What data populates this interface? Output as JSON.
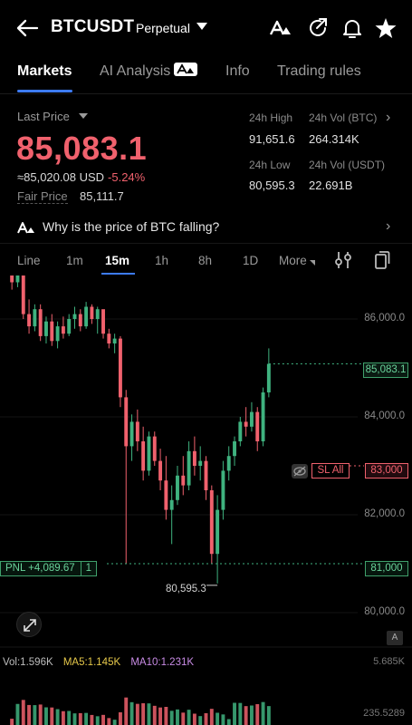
{
  "header": {
    "symbol": "BTCUSDT",
    "contract_type": "Perpetual",
    "icons": [
      "back-arrow-icon",
      "ai-assistant-icon",
      "share-refresh-icon",
      "bell-icon",
      "star-icon"
    ]
  },
  "tabs": [
    {
      "label": "Markets",
      "active": true
    },
    {
      "label": "AI Analysis",
      "badge": "AI"
    },
    {
      "label": "Info"
    },
    {
      "label": "Trading rules"
    }
  ],
  "ticker": {
    "last_price_label": "Last Price",
    "last_price": "85,083.1",
    "usd_equiv": "≈85,020.08 USD",
    "change_pct": "-5.24%",
    "fair_price_label": "Fair Price",
    "fair_price": "85,111.7",
    "high_label": "24h High",
    "high": "91,651.6",
    "vol_btc_label": "24h Vol (BTC)",
    "vol_btc": "264.314K",
    "low_label": "24h Low",
    "low": "80,595.3",
    "vol_usdt_label": "24h Vol (USDT)",
    "vol_usdt": "22.691B"
  },
  "ai_prompt": {
    "text": "Why is the price of BTC falling?"
  },
  "intervals": [
    {
      "label": "Line"
    },
    {
      "label": "1m"
    },
    {
      "label": "15m",
      "active": true
    },
    {
      "label": "1h"
    },
    {
      "label": "8h"
    },
    {
      "label": "1D"
    },
    {
      "label": "More"
    }
  ],
  "chart": {
    "y_ticks": [
      "86,000.0",
      "84,000.0",
      "82,000.0",
      "80,000.0"
    ],
    "current_price_tag": "85,083.1",
    "sl_label": "SL  All",
    "sl_price": "83,000",
    "pnl_label": "PNL +4,089.67",
    "position_qty": "1",
    "position_price": "81,000",
    "low_marker": "80,595.3",
    "auto_badge": "A",
    "colors": {
      "up": "#3fb27f",
      "down": "#f0616d",
      "accent": "#3d7bf7"
    }
  },
  "chart_data": {
    "type": "candlestick",
    "ylim": [
      79700,
      87100
    ],
    "candles": [
      [
        87100,
        87200,
        86600,
        86750
      ],
      [
        86750,
        87050,
        86650,
        86900
      ],
      [
        86900,
        87000,
        86000,
        86100
      ],
      [
        86100,
        86400,
        85700,
        85850
      ],
      [
        85850,
        86300,
        85750,
        86200
      ],
      [
        86200,
        86300,
        85550,
        85650
      ],
      [
        85650,
        86050,
        85500,
        85950
      ],
      [
        85950,
        86100,
        85450,
        85550
      ],
      [
        85550,
        85950,
        85400,
        85850
      ],
      [
        85850,
        86050,
        85600,
        85700
      ],
      [
        85700,
        86100,
        85650,
        86000
      ],
      [
        86000,
        86250,
        85800,
        86100
      ],
      [
        86100,
        86200,
        85750,
        85850
      ],
      [
        85850,
        86350,
        85800,
        86250
      ],
      [
        86250,
        86300,
        85900,
        86000
      ],
      [
        86000,
        86250,
        85700,
        86200
      ],
      [
        86200,
        86150,
        85600,
        85700
      ],
      [
        85700,
        85800,
        85400,
        85500
      ],
      [
        85500,
        85700,
        85300,
        85600
      ],
      [
        85600,
        85650,
        84200,
        84400
      ],
      [
        84400,
        84550,
        81000,
        83400
      ],
      [
        83400,
        84050,
        83100,
        83900
      ],
      [
        83900,
        84150,
        83300,
        83500
      ],
      [
        83500,
        83800,
        82700,
        82900
      ],
      [
        82900,
        83700,
        82800,
        83600
      ],
      [
        83600,
        83700,
        83000,
        83100
      ],
      [
        83100,
        83350,
        82500,
        82700
      ],
      [
        82700,
        83200,
        81900,
        82100
      ],
      [
        82100,
        82600,
        81400,
        82300
      ],
      [
        82300,
        83000,
        82200,
        82800
      ],
      [
        82800,
        83200,
        82400,
        82600
      ],
      [
        82600,
        83500,
        82500,
        83300
      ],
      [
        83300,
        83600,
        82800,
        83000
      ],
      [
        83000,
        83400,
        82700,
        83100
      ],
      [
        83100,
        83200,
        82300,
        82500
      ],
      [
        82500,
        82600,
        81000,
        81200
      ],
      [
        81200,
        82400,
        80595.3,
        82100
      ],
      [
        82100,
        83100,
        81900,
        82900
      ],
      [
        82900,
        83400,
        82700,
        83200
      ],
      [
        83200,
        83600,
        83000,
        83500
      ],
      [
        83500,
        84000,
        83400,
        83900
      ],
      [
        83900,
        84200,
        83600,
        83800
      ],
      [
        83800,
        84300,
        83700,
        84100
      ],
      [
        84100,
        84200,
        83300,
        83500
      ],
      [
        83500,
        84600,
        83400,
        84500
      ],
      [
        84500,
        85400,
        84400,
        85083.1
      ]
    ],
    "volume_labels": [
      "Vol:1.596K",
      "MA5:1.145K",
      "MA10:1.231K"
    ],
    "volume_max": "5.685K",
    "volume_min": "235.5289"
  }
}
